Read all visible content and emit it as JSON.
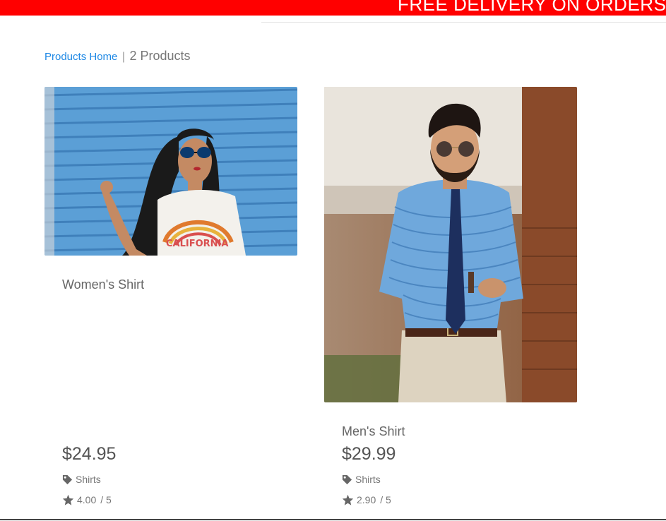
{
  "banner": {
    "text": "FREE DELIVERY ON ORDERS",
    "color": "#ff0000"
  },
  "breadcrumb": {
    "home_label": "Products Home",
    "separator": "|",
    "count_label": "2 Products",
    "link_color": "#1e88e5"
  },
  "products": [
    {
      "name": "Women's Shirt",
      "price": "$24.95",
      "category": "Shirts",
      "category_icon": "tag-icon",
      "rating": "4.00",
      "rating_max": "/ 5",
      "rating_icon": "star-icon",
      "image_alt": "woman-in-california-tshirt-image"
    },
    {
      "name": "Men's Shirt",
      "price": "$29.99",
      "category": "Shirts",
      "category_icon": "tag-icon",
      "rating": "2.90",
      "rating_max": "/ 5",
      "rating_icon": "star-icon",
      "image_alt": "man-in-blue-shirt-image"
    }
  ]
}
